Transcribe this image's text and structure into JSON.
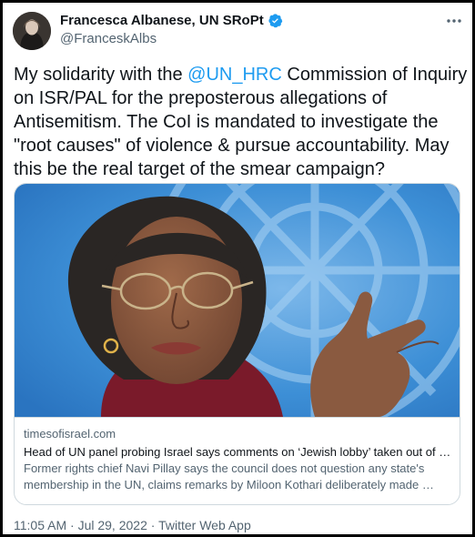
{
  "author": {
    "display_name": "Francesca Albanese, UN SRoPt",
    "handle": "@FranceskAlbs"
  },
  "tweet": {
    "text_before_mention": "My solidarity with the ",
    "mention": "@UN_HRC",
    "text_after_mention": " Commission of Inquiry on ISR/PAL for the preposterous allegations of Antisemitism. The CoI is mandated to investigate the \"root causes\" of violence & pursue accountability. May this be the real target of the smear campaign?"
  },
  "link_card": {
    "domain": "timesofisrael.com",
    "title": "Head of UN panel probing Israel says comments on ‘Jewish lobby’ taken out of …",
    "description": "Former rights chief Navi Pillay says the council does not question any state's membership in the UN, claims remarks by Miloon Kothari deliberately made …"
  },
  "timestamp": {
    "time": "11:05 AM",
    "separator": " · ",
    "date": "Jul 29, 2022",
    "source": "Twitter Web App"
  },
  "colors": {
    "link_blue": "#1d9bf0",
    "verified_blue": "#1d9bf0",
    "text_primary": "#0f1419",
    "text_secondary": "#536471",
    "un_backdrop_blue": "#3d8fd6"
  },
  "icons": {
    "verified": "verified-badge-icon",
    "more": "more-horizontal-icon"
  }
}
